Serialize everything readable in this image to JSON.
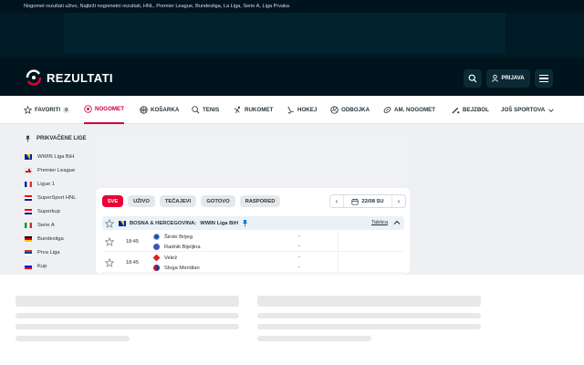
{
  "seo_text": "Nogomet rezultati uživo, Najbrži nogometni rezultati, HNL, Premier League, Bundesliga, La Liga, Serie A, Liga Prvaka",
  "brand": {
    "name": "REZULTATI",
    "accent": "#ea0037"
  },
  "header": {
    "login_label": "PRIJAVA",
    "search_icon": "search-icon",
    "menu_icon": "hamburger-icon"
  },
  "nav": {
    "items": [
      {
        "label": "FAVORITI",
        "badge": "0",
        "icon": "star-icon"
      },
      {
        "label": "NOGOMET",
        "icon": "soccer-ball-icon",
        "active": true
      },
      {
        "label": "KOŠARKA",
        "icon": "basketball-icon"
      },
      {
        "label": "TENIS",
        "icon": "tennis-icon"
      },
      {
        "label": "RUKOMET",
        "icon": "handball-icon"
      },
      {
        "label": "HOKEJ",
        "icon": "hockey-icon"
      },
      {
        "label": "ODBOJKA",
        "icon": "volleyball-icon"
      },
      {
        "label": "AM. NOGOMET",
        "icon": "american-football-icon"
      },
      {
        "label": "BEJZBOL",
        "icon": "baseball-icon"
      },
      {
        "label": "JOŠ SPORTOVA",
        "icon": "chevron-down-icon"
      }
    ]
  },
  "sidebar": {
    "title": "PRIKVAČENE LIGE",
    "leagues": [
      {
        "name": "WWIN Liga BiH",
        "flag": "ba"
      },
      {
        "name": "Premier League",
        "flag": "en"
      },
      {
        "name": "Ligue 1",
        "flag": "fr"
      },
      {
        "name": "SuperSport HNL",
        "flag": "hr"
      },
      {
        "name": "Superkup",
        "flag": "hr"
      },
      {
        "name": "Serie A",
        "flag": "it"
      },
      {
        "name": "Bundesliga",
        "flag": "de"
      },
      {
        "name": "Prva Liga",
        "flag": "rs"
      },
      {
        "name": "Kup",
        "flag": "si"
      }
    ]
  },
  "filters": {
    "tabs": [
      "SVE",
      "UŽIVO",
      "TEČAJEVI",
      "GOTOVO",
      "RASPORED"
    ],
    "active": "SVE",
    "date": "22/08 SU"
  },
  "league_header": {
    "country": "BOSNA & HERCEGOVINA:",
    "league": "WWIN Liga BiH",
    "table_link": "Tablica"
  },
  "matches": [
    {
      "time": "18:45",
      "home": "Široki Brijeg",
      "away": "Radnik Bijeljina",
      "home_score": "-",
      "away_score": "-"
    },
    {
      "time": "18:45",
      "home": "Velež",
      "away": "Sloga Meridian",
      "home_score": "-",
      "away_score": "-"
    }
  ]
}
